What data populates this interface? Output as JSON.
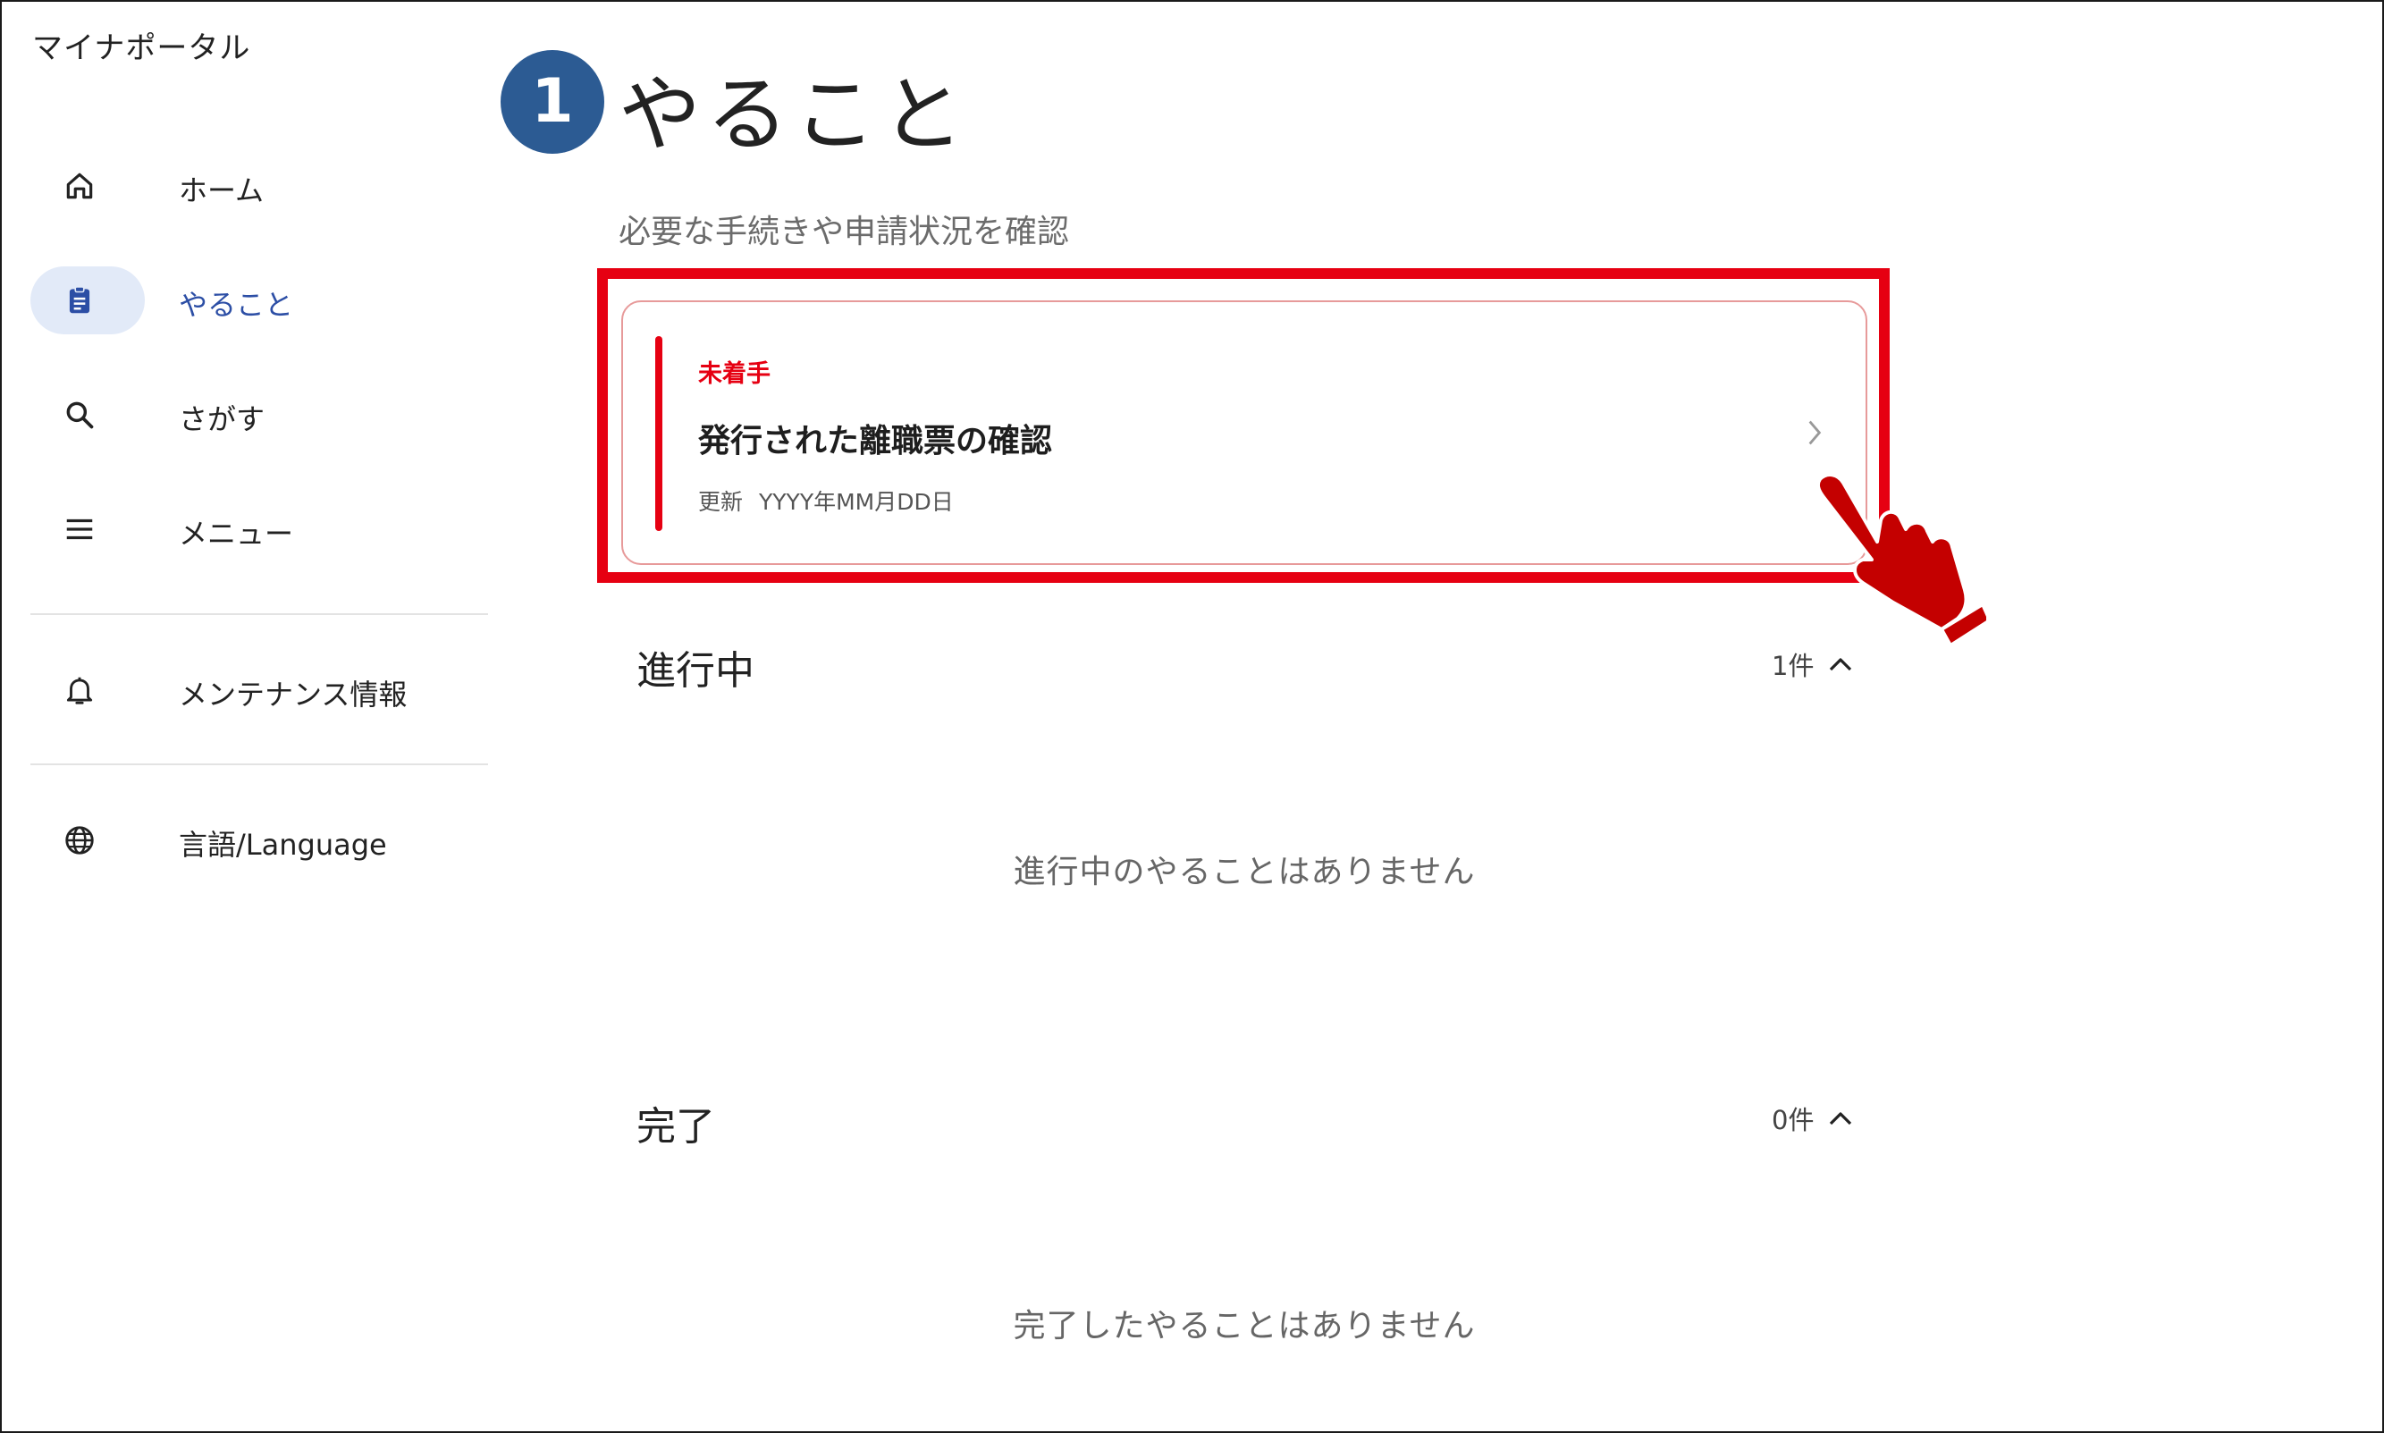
{
  "app": {
    "title": "マイナポータル"
  },
  "sidebar": {
    "items": [
      {
        "label": "ホーム",
        "icon": "home-icon"
      },
      {
        "label": "やること",
        "icon": "clipboard-icon",
        "active": true
      },
      {
        "label": "さがす",
        "icon": "search-icon"
      },
      {
        "label": "メニュー",
        "icon": "menu-icon"
      },
      {
        "label": "メンテナンス情報",
        "icon": "bell-icon"
      },
      {
        "label": "言語/Language",
        "icon": "globe-icon"
      }
    ]
  },
  "main": {
    "step_number": "1",
    "title": "やること",
    "subtitle": "必要な手続きや申請状況を確認",
    "task": {
      "status": "未着手",
      "title": "発行された離職票の確認",
      "updated_label": "更新",
      "updated_value": "YYYY年MM月DD日"
    },
    "sections": [
      {
        "title": "進行中",
        "count": "1件",
        "empty_message": "進行中のやることはありません"
      },
      {
        "title": "完了",
        "count": "0件",
        "empty_message": "完了したやることはありません"
      }
    ]
  },
  "colors": {
    "accent_red": "#e60012",
    "active_blue": "#2c4ea5",
    "step_badge": "#2c5b93",
    "hand": "#c40000"
  }
}
